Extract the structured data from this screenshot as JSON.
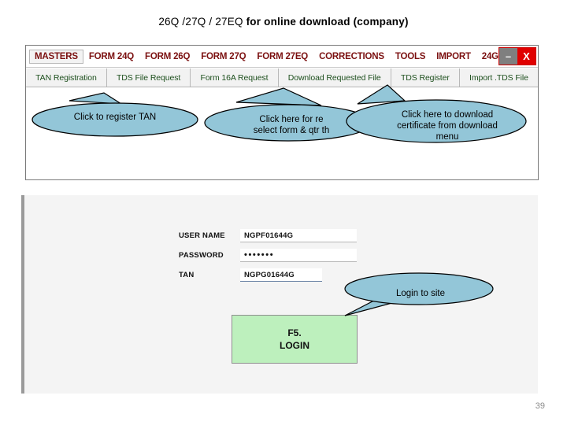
{
  "slide": {
    "title_light": "26Q /27Q / 27EQ ",
    "title_bold": "for online download  (company)",
    "page_number": "39"
  },
  "app_window": {
    "menu": [
      {
        "label": "MASTERS",
        "selected": true
      },
      {
        "label": "FORM 24Q",
        "selected": false
      },
      {
        "label": "FORM 26Q",
        "selected": false
      },
      {
        "label": "FORM 27Q",
        "selected": false
      },
      {
        "label": "FORM 27EQ",
        "selected": false
      },
      {
        "label": "CORRECTIONS",
        "selected": false
      },
      {
        "label": "TOOLS",
        "selected": false
      },
      {
        "label": "IMPORT",
        "selected": false
      },
      {
        "label": "24G",
        "selected": false
      }
    ],
    "window_controls": {
      "minimize": "–",
      "close": "X"
    },
    "toolbar": [
      {
        "label": "TAN Registration"
      },
      {
        "label": "TDS File Request"
      },
      {
        "label": "Form 16A Request"
      },
      {
        "label": "Download Requested File"
      },
      {
        "label": "TDS Register"
      },
      {
        "label": "Import .TDS File"
      }
    ]
  },
  "callouts": {
    "tan": "Click to register TAN",
    "form_line1": "Click here for re",
    "form_line2": "select form & qtr th",
    "download_line1": "Click here to download",
    "download_line2": "certificate from download",
    "download_line3": "menu",
    "login": "Login to site"
  },
  "login_panel": {
    "fields": [
      {
        "label": "USER NAME",
        "value": "NGPF01644G"
      },
      {
        "label": "PASSWORD",
        "value": "•••••••"
      },
      {
        "label": "TAN",
        "value": "NGPG01644G"
      }
    ],
    "button_line1": "F5.",
    "button_line2": "LOGIN"
  },
  "colors": {
    "callout_fill": "#93c6d8",
    "callout_stroke": "#000000",
    "login_button": "#bdf0bd",
    "menu_text": "#7b1010",
    "toolbar_text": "#1d4f1d",
    "close_button": "#e00000",
    "minimize_button": "#7f7f7f"
  }
}
